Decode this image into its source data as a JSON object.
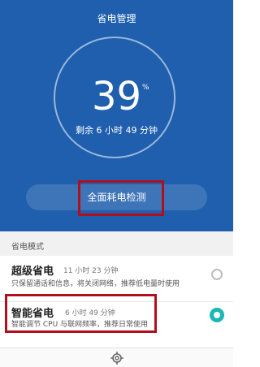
{
  "title": "省电管理",
  "battery": {
    "percent": "39",
    "percent_sign": "%",
    "remaining": "剩余 6 小时 49 分钟"
  },
  "check_button": "全面耗电检测",
  "section_label": "省电模式",
  "modes": [
    {
      "title": "超级省电",
      "time": "11 小时 23 分钟",
      "desc": "只保留通话和信息，将关闭网络，推荐低电量时使用",
      "selected": false
    },
    {
      "title": "智能省电",
      "time": "6 小时 49 分钟",
      "desc": "智能调节 CPU 与联网频率，推荐日常使用",
      "selected": true
    }
  ],
  "colors": {
    "header_bg": "#1f5fae",
    "accent": "#19b8b5",
    "highlight": "#b20f1c"
  },
  "icons": {
    "settings": "gear-icon"
  }
}
